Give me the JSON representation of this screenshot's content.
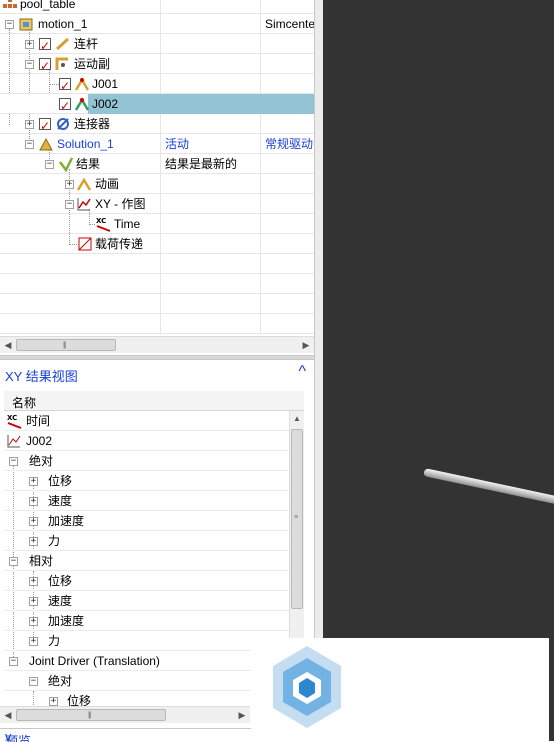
{
  "navigator": {
    "rows": [
      {
        "label": "pool_table"
      },
      {
        "label": "motion_1",
        "col3": "Simcente"
      },
      {
        "label": "连杆"
      },
      {
        "label": "运动副"
      },
      {
        "label": "J001"
      },
      {
        "label": "J002"
      },
      {
        "label": "连接器"
      },
      {
        "label": "Solution_1",
        "col2": "活动",
        "col3": "常规驱动"
      },
      {
        "label": "结果",
        "col2": "结果是最新的"
      },
      {
        "label": "动画"
      },
      {
        "label": "XY - 作图"
      },
      {
        "label": "Time"
      },
      {
        "label": "载荷传递"
      }
    ]
  },
  "xy_panel": {
    "title": "XY 结果视图",
    "column_header": "名称",
    "rows": [
      {
        "label": "时间"
      },
      {
        "label": "J002"
      },
      {
        "label": "绝对"
      },
      {
        "label": "位移"
      },
      {
        "label": "速度"
      },
      {
        "label": "加速度"
      },
      {
        "label": "力"
      },
      {
        "label": "相对"
      },
      {
        "label": "位移"
      },
      {
        "label": "速度"
      },
      {
        "label": "加速度"
      },
      {
        "label": "力"
      },
      {
        "label": "Joint Driver (Translation)"
      },
      {
        "label": "绝对"
      },
      {
        "label": "位移"
      }
    ]
  },
  "footer": {
    "label": "预览"
  },
  "colors": {
    "accent": "#1a3fd6",
    "selection": "#93c4d4",
    "viewport_bg": "#333333",
    "check": "#d00000"
  },
  "icons": [
    "assembly-icon",
    "motion-icon",
    "link-icon",
    "joint-icon",
    "connector-icon",
    "solution-icon",
    "results-icon",
    "animation-icon",
    "xy-plot-icon",
    "time-icon",
    "load-transfer-icon"
  ]
}
